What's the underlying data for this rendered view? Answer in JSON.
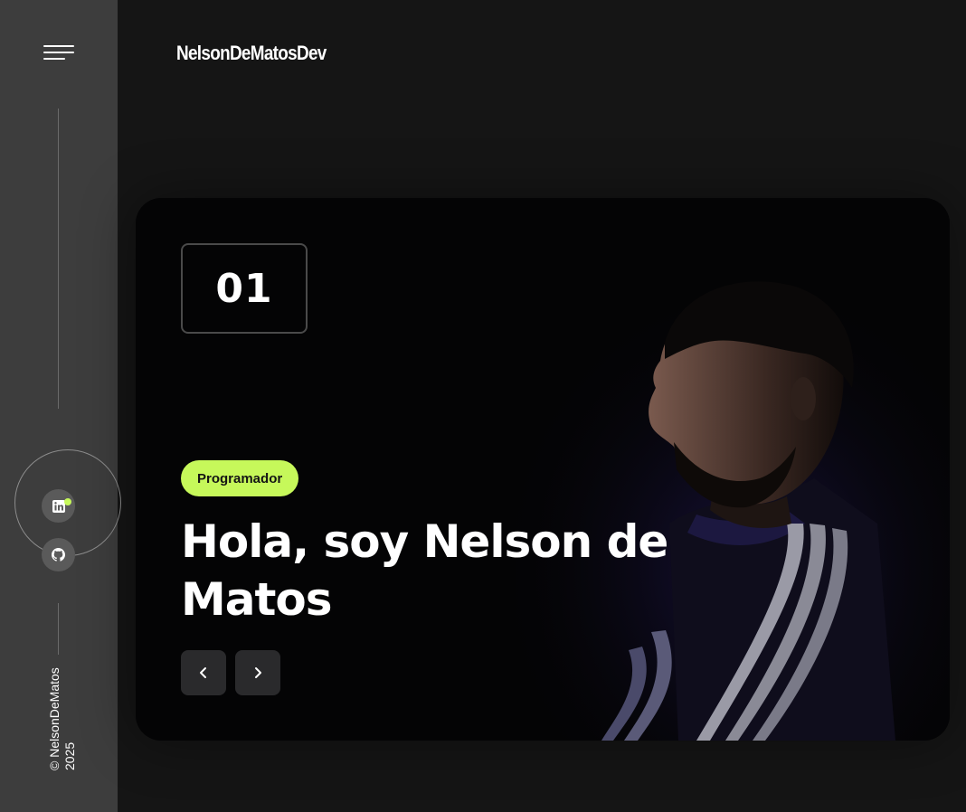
{
  "brand": {
    "name": "NelsonDeMatosDev"
  },
  "sidebar": {
    "menu_icon": "hamburger-menu-icon",
    "socials": [
      {
        "name": "LinkedIn",
        "icon": "linkedin-icon"
      },
      {
        "name": "GitHub",
        "icon": "github-icon"
      }
    ],
    "copyright_line1": "© NelsonDeMatos",
    "copyright_line2": "2025"
  },
  "hero": {
    "slide_number": "01",
    "badge": "Programador",
    "headline": "Hola, soy Nelson de Matos",
    "prev_icon": "chevron-left-icon",
    "next_icon": "chevron-right-icon"
  },
  "colors": {
    "accent": "#c6f85a",
    "sidebar_bg": "#3d3d3d",
    "page_bg": "#151515",
    "card_bg": "#040405"
  }
}
